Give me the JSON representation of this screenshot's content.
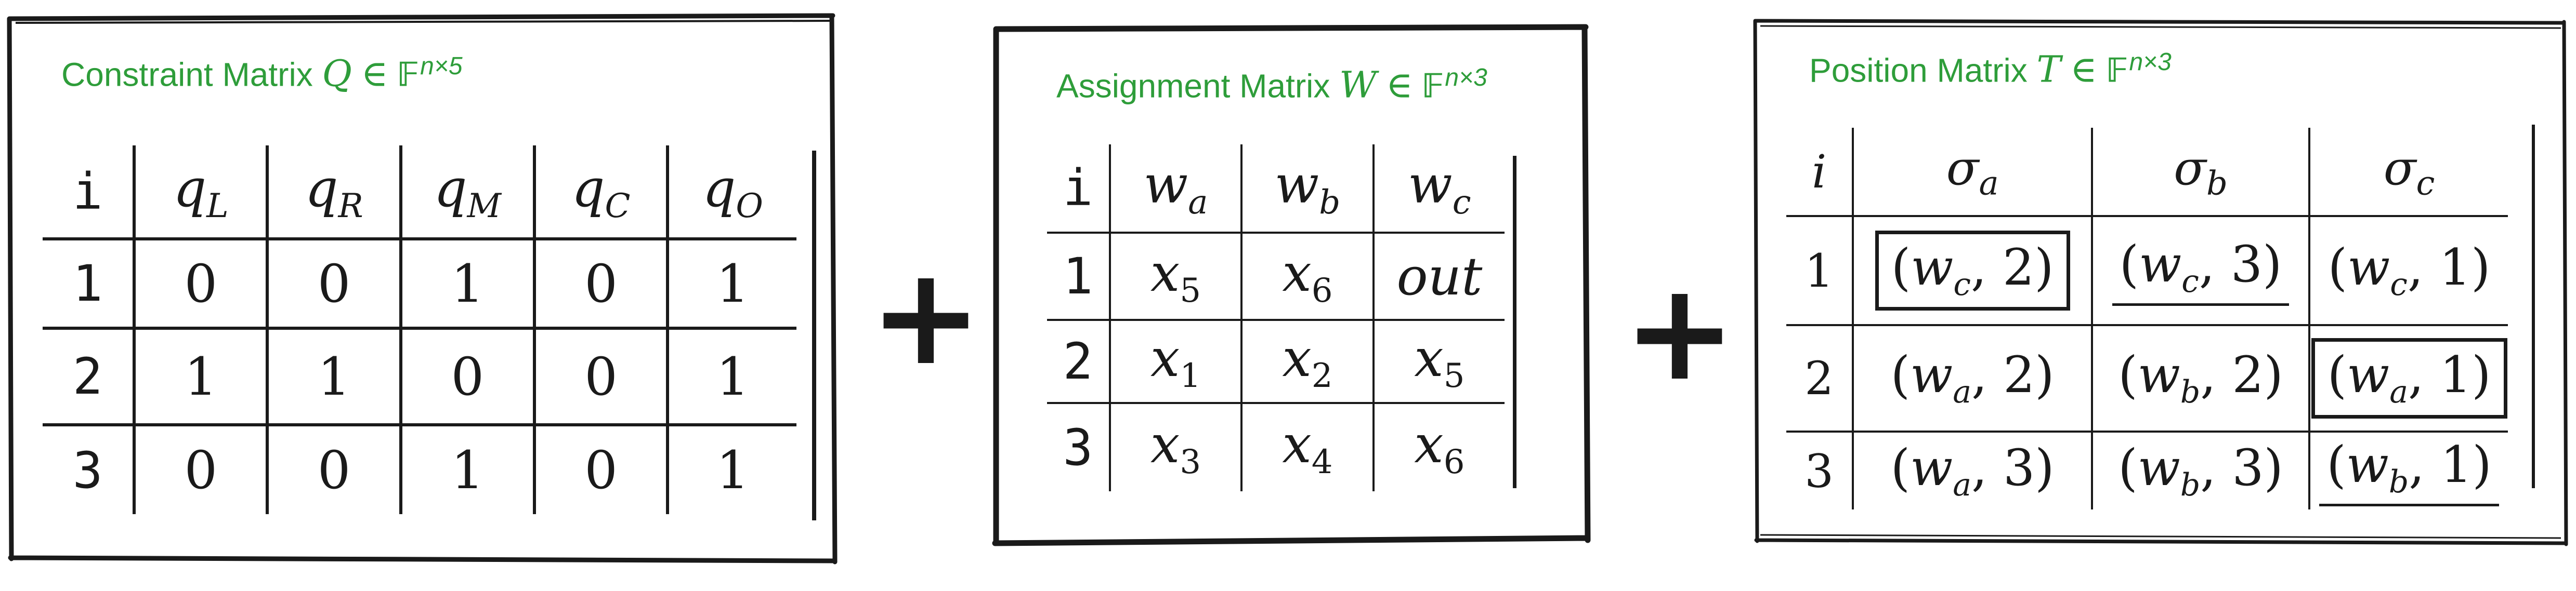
{
  "constraint_matrix": {
    "title_text": "Constraint Matrix",
    "title_symbol": "Q",
    "title_set": "𝔽",
    "title_exp": "n×5",
    "index_header": "i",
    "headers": [
      {
        "base": "q",
        "sub": "L"
      },
      {
        "base": "q",
        "sub": "R"
      },
      {
        "base": "q",
        "sub": "M"
      },
      {
        "base": "q",
        "sub": "C"
      },
      {
        "base": "q",
        "sub": "O"
      }
    ],
    "rows": [
      {
        "i": "1",
        "cells": [
          "0",
          "0",
          "1",
          "0",
          "1"
        ]
      },
      {
        "i": "2",
        "cells": [
          "1",
          "1",
          "0",
          "0",
          "1"
        ]
      },
      {
        "i": "3",
        "cells": [
          "0",
          "0",
          "1",
          "0",
          "1"
        ]
      }
    ]
  },
  "plus_sign": "+",
  "assignment_matrix": {
    "title_text": "Assignment Matrix",
    "title_symbol": "W",
    "title_set": "𝔽",
    "title_exp": "n×3",
    "index_header": "i",
    "headers": [
      {
        "base": "w",
        "sub": "a"
      },
      {
        "base": "w",
        "sub": "b"
      },
      {
        "base": "w",
        "sub": "c"
      }
    ],
    "rows": [
      {
        "i": "1",
        "cells": [
          {
            "base": "x",
            "sub": "5"
          },
          {
            "base": "x",
            "sub": "6"
          },
          {
            "base": "out",
            "sub": ""
          }
        ]
      },
      {
        "i": "2",
        "cells": [
          {
            "base": "x",
            "sub": "1"
          },
          {
            "base": "x",
            "sub": "2"
          },
          {
            "base": "x",
            "sub": "5"
          }
        ]
      },
      {
        "i": "3",
        "cells": [
          {
            "base": "x",
            "sub": "3"
          },
          {
            "base": "x",
            "sub": "4"
          },
          {
            "base": "x",
            "sub": "6"
          }
        ]
      }
    ]
  },
  "position_matrix": {
    "title_text": "Position Matrix",
    "title_symbol": "T",
    "title_set": "𝔽",
    "title_exp": "n×3",
    "index_header": "i",
    "headers": [
      {
        "base": "σ",
        "sub": "a"
      },
      {
        "base": "σ",
        "sub": "b"
      },
      {
        "base": "σ",
        "sub": "c"
      }
    ],
    "rows": [
      {
        "i": "1",
        "cells": [
          {
            "w": "w",
            "wsub": "c",
            "n": "2",
            "mark": "boxed"
          },
          {
            "w": "w",
            "wsub": "c",
            "n": "3",
            "mark": "underlined"
          },
          {
            "w": "w",
            "wsub": "c",
            "n": "1",
            "mark": "none"
          }
        ]
      },
      {
        "i": "2",
        "cells": [
          {
            "w": "w",
            "wsub": "a",
            "n": "2",
            "mark": "none"
          },
          {
            "w": "w",
            "wsub": "b",
            "n": "2",
            "mark": "none"
          },
          {
            "w": "w",
            "wsub": "a",
            "n": "1",
            "mark": "boxed"
          }
        ]
      },
      {
        "i": "3",
        "cells": [
          {
            "w": "w",
            "wsub": "a",
            "n": "3",
            "mark": "none"
          },
          {
            "w": "w",
            "wsub": "b",
            "n": "3",
            "mark": "none"
          },
          {
            "w": "w",
            "wsub": "b",
            "n": "1",
            "mark": "underlined"
          }
        ]
      }
    ]
  }
}
